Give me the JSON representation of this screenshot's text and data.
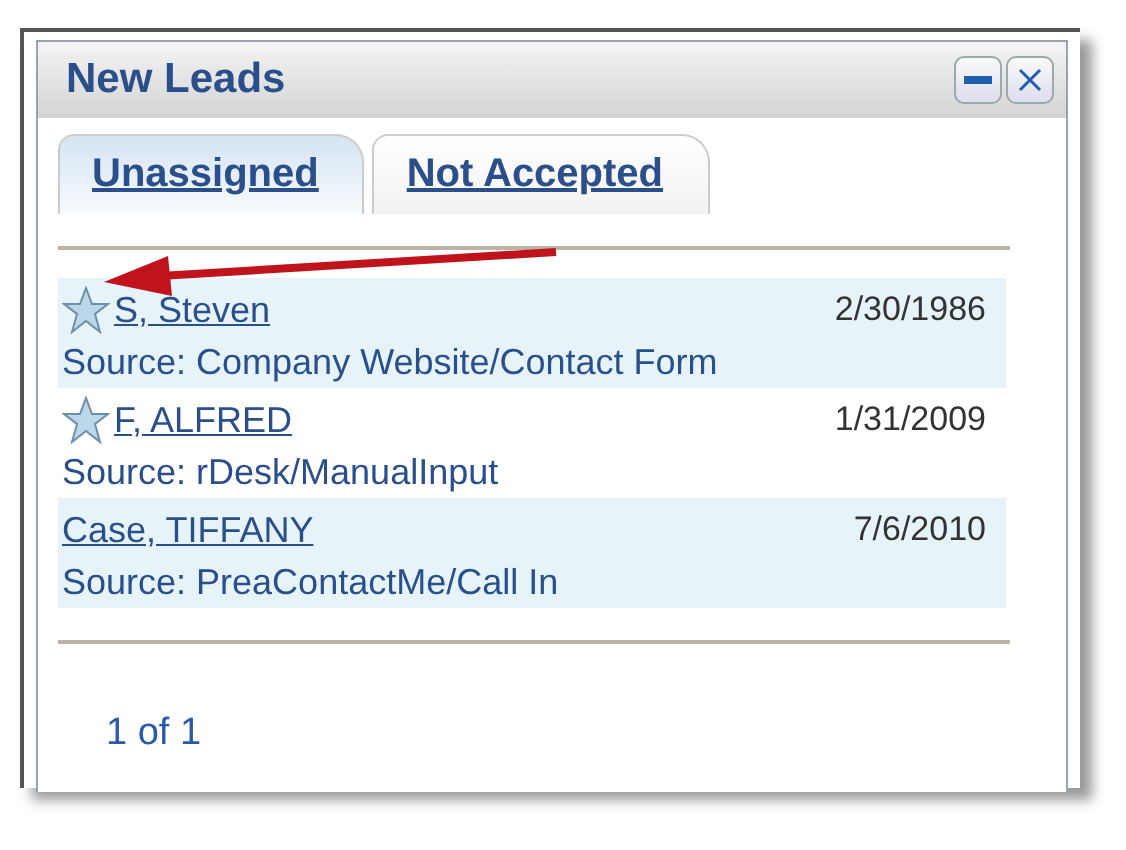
{
  "panel": {
    "title": "New Leads",
    "buttons": [
      {
        "kind": "minimize"
      },
      {
        "kind": "close"
      }
    ]
  },
  "tabs": [
    {
      "label": "Unassigned",
      "selected": true
    },
    {
      "label": "Not Accepted",
      "selected": false
    }
  ],
  "leads": [
    {
      "name": "S, Steven",
      "date": "2/30/1986",
      "source": "Source: Company Website/Contact Form",
      "starred": true
    },
    {
      "name": "F, ALFRED",
      "date": "1/31/2009",
      "source": "Source: rDesk/ManualInput",
      "starred": true
    },
    {
      "name": "Case, TIFFANY",
      "date": "7/6/2010",
      "source": "Source: PreaContactMe/Call In",
      "starred": false
    }
  ],
  "pager": "1 of 1"
}
